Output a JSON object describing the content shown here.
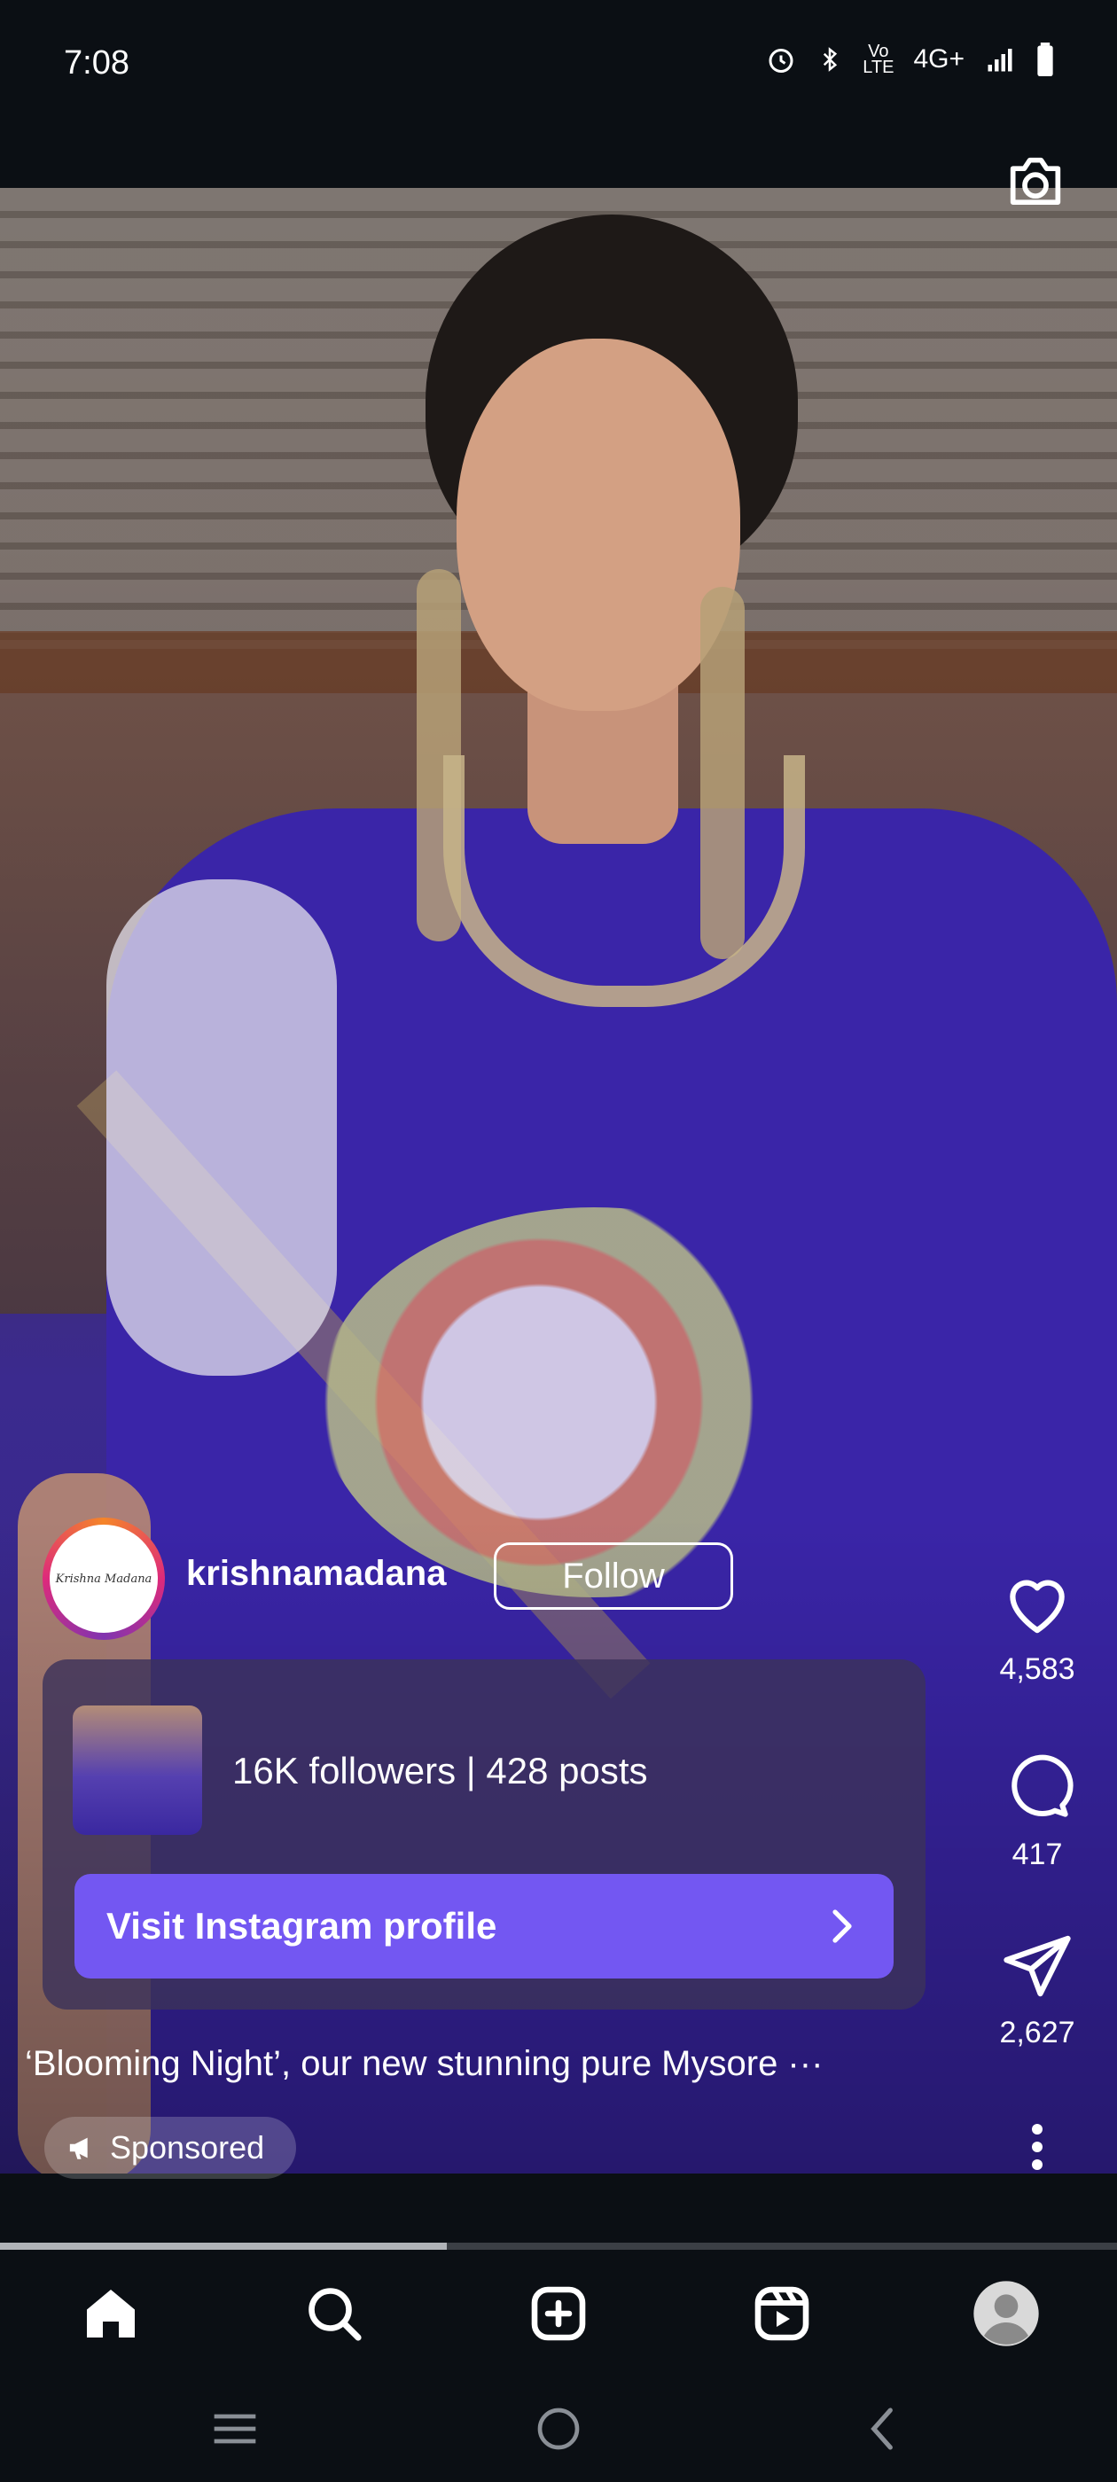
{
  "status": {
    "time": "7:08",
    "network": "4G+"
  },
  "reel": {
    "username": "krishnamadana",
    "avatar_text": "Krishna Madana",
    "follow_label": "Follow",
    "card": {
      "stats": "16K followers | 428 posts",
      "visit_label": "Visit Instagram profile"
    },
    "caption": "‘Blooming Night’, our new stunning pure Mysore ···",
    "sponsored_label": "Sponsored",
    "actions": {
      "likes": "4,583",
      "comments": "417",
      "shares": "2,627"
    },
    "progress": 0.4
  },
  "nav": {
    "items": [
      "home-icon",
      "search-icon",
      "create-icon",
      "reels-icon",
      "profile-icon"
    ]
  },
  "colors": {
    "accent": "#7357f2",
    "background": "#0b0f14"
  }
}
